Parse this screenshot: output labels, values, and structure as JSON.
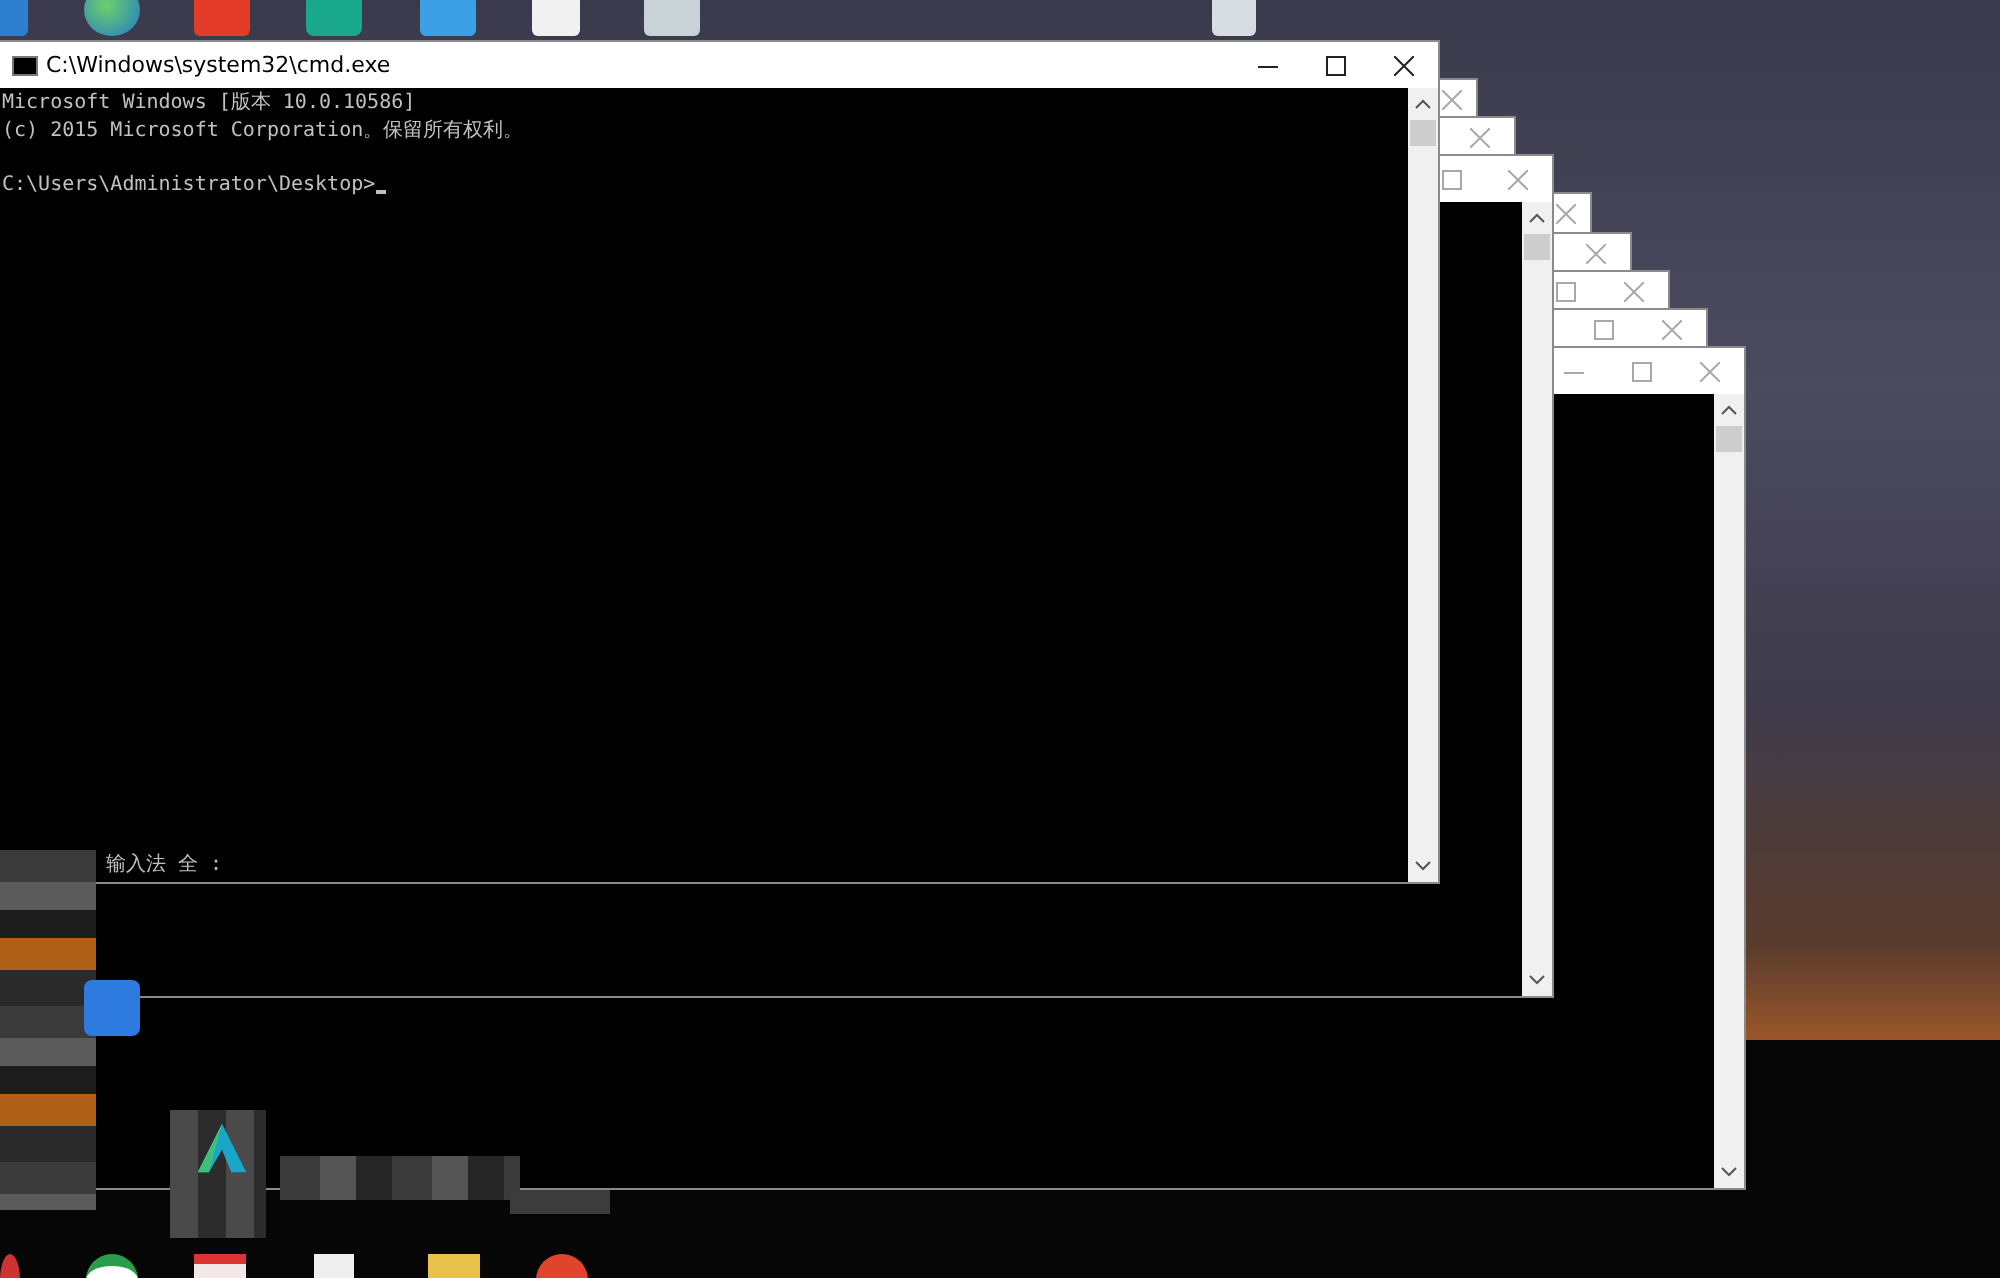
{
  "windows": [
    {
      "focused": true,
      "title": "C:\\Windows\\system32\\cmd.exe",
      "lines": [
        "Microsoft Windows [版本 10.0.10586]",
        "(c) 2015 Microsoft Corporation。保留所有权利。"
      ],
      "prompt": "C:\\Users\\Administrator\\Desktop>",
      "ime_status": "输入法 全 :"
    },
    {
      "focused": false
    },
    {
      "focused": false
    },
    {
      "focused": false
    },
    {
      "focused": false
    },
    {
      "focused": false
    },
    {
      "focused": false
    },
    {
      "focused": false
    },
    {
      "focused": false
    }
  ]
}
